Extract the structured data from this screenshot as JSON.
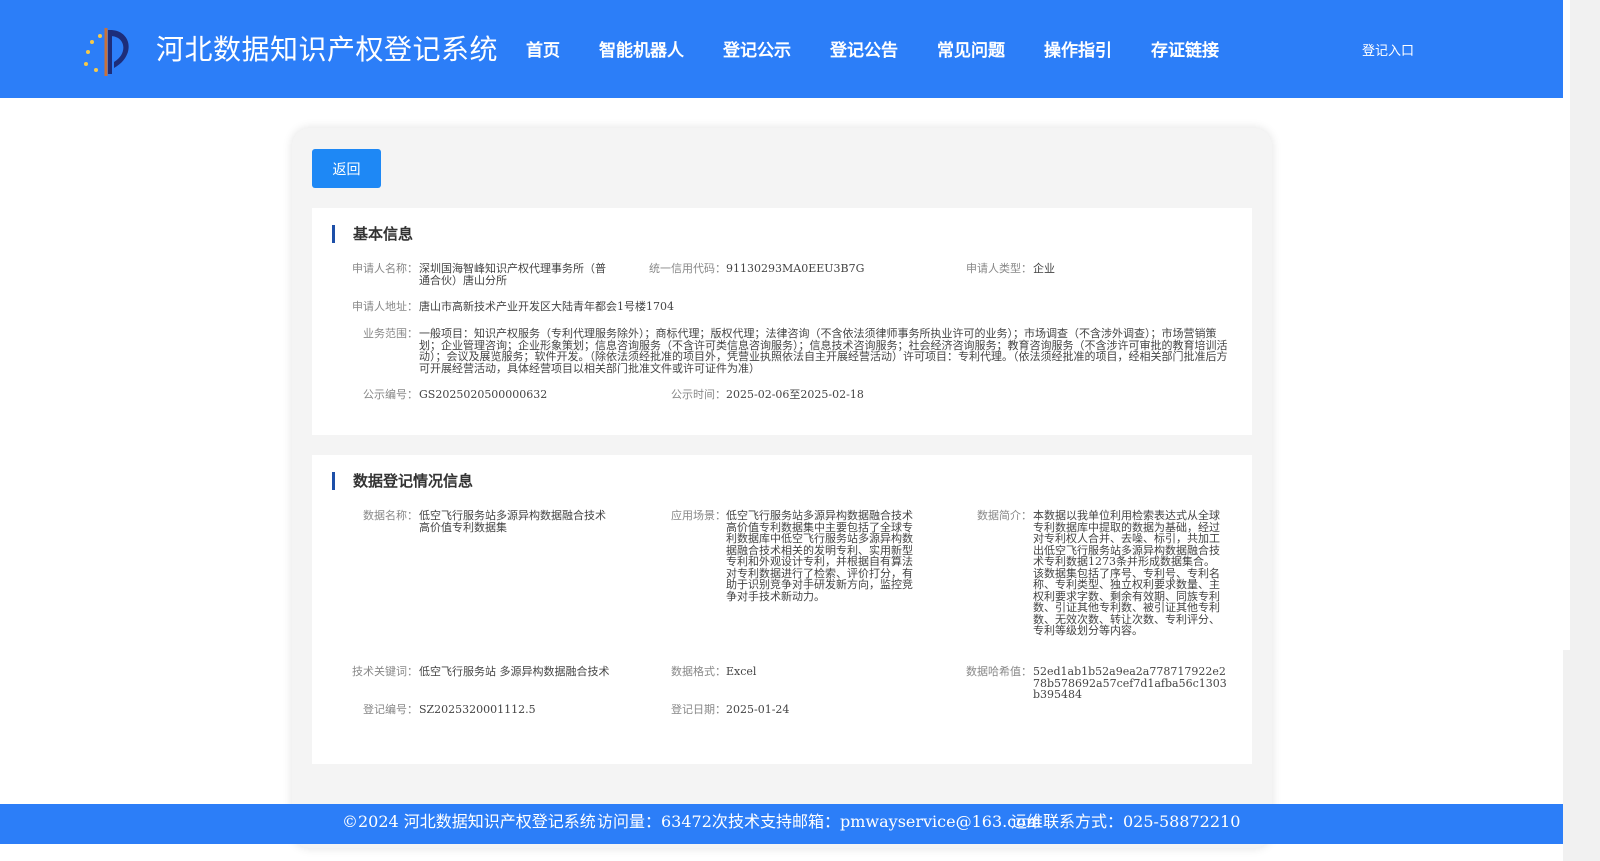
{
  "header": {
    "title": "河北数据知识产权登记系统",
    "nav": [
      "首页",
      "智能机器人",
      "登记公示",
      "登记公告",
      "常见问题",
      "操作指引",
      "存证链接"
    ],
    "login": "登记入口"
  },
  "back_label": "返回",
  "basic": {
    "title": "基本信息",
    "applicant_name_label": "申请人名称：",
    "applicant_name": "深圳国海智峰知识产权代理事务所（普通合伙）唐山分所",
    "credit_code_label": "统一信用代码：",
    "credit_code": "91130293MA0EEU3B7G",
    "applicant_type_label": "申请人类型：",
    "applicant_type": "企业",
    "address_label": "申请人地址：",
    "address": "唐山市高新技术产业开发区大陆青年都会1号楼1704",
    "scope_label": "业务范围：",
    "scope": "一般项目：知识产权服务（专利代理服务除外）；商标代理；版权代理；法律咨询（不含依法须律师事务所执业许可的业务）；市场调查（不含涉外调查）；市场营销策划；企业管理咨询；企业形象策划；信息咨询服务（不含许可类信息咨询服务）；信息技术咨询服务；社会经济咨询服务；教育咨询服务（不含涉许可审批的教育培训活动）；会议及展览服务；软件开发。（除依法须经批准的项目外，凭营业执照依法自主开展经营活动）许可项目：专利代理。（依法须经批准的项目，经相关部门批准后方可开展经营活动，具体经营项目以相关部门批准文件或许可证件为准）",
    "notice_no_label": "公示编号：",
    "notice_no": "GS2025020500000632",
    "notice_time_label": "公示时间：",
    "notice_time": "2025-02-06至2025-02-18"
  },
  "data_reg": {
    "title": "数据登记情况信息",
    "data_name_label": "数据名称：",
    "data_name": "低空飞行服务站多源异构数据融合技术高价值专利数据集",
    "scenario_label": "应用场景：",
    "scenario": "低空飞行服务站多源异构数据融合技术高价值专利数据集中主要包括了全球专利数据库中低空飞行服务站多源异构数据融合技术相关的发明专利、实用新型专利和外观设计专利，并根据自有算法对专利数据进行了检索、评价打分，有助于识别竞争对手研发新方向，监控竞争对手技术新动力。",
    "intro_label": "数据简介：",
    "intro": "本数据以我单位利用检索表达式从全球专利数据库中提取的数据为基础，经过对专利权人合并、去噪、标引，共加工出低空飞行服务站多源异构数据融合技术专利数据1273条并形成数据集合。该数据集包括了序号、专利号、专利名称、专利类型、独立权利要求数量、主权利要求字数、剩余有效期、同族专利数、引证其他专利数、被引证其他专利数、无效次数、转让次数、专利评分、专利等级划分等内容。",
    "keywords_label": "技术关键词：",
    "keywords": "低空飞行服务站 多源异构数据融合技术",
    "format_label": "数据格式：",
    "format": "Excel",
    "hash_label": "数据哈希值：",
    "hash": "52ed1ab1b52a9ea2a778717922e278b578692a57cef7d1afba56c1303b395484",
    "reg_no_label": "登记编号：",
    "reg_no": "SZ2025320001112.5",
    "reg_date_label": "登记日期：",
    "reg_date": "2025-01-24"
  },
  "footer": {
    "copyright": "©2024 河北数据知识产权登记系统",
    "visits": "访问量：63472次",
    "email": "技术支持邮箱：pmwayservice@163.com",
    "phone": "运维联系方式：025-58872210"
  },
  "colors": {
    "brand": "#2c7ef8",
    "button": "#1e88f5",
    "accent": "#1d4fa8"
  }
}
